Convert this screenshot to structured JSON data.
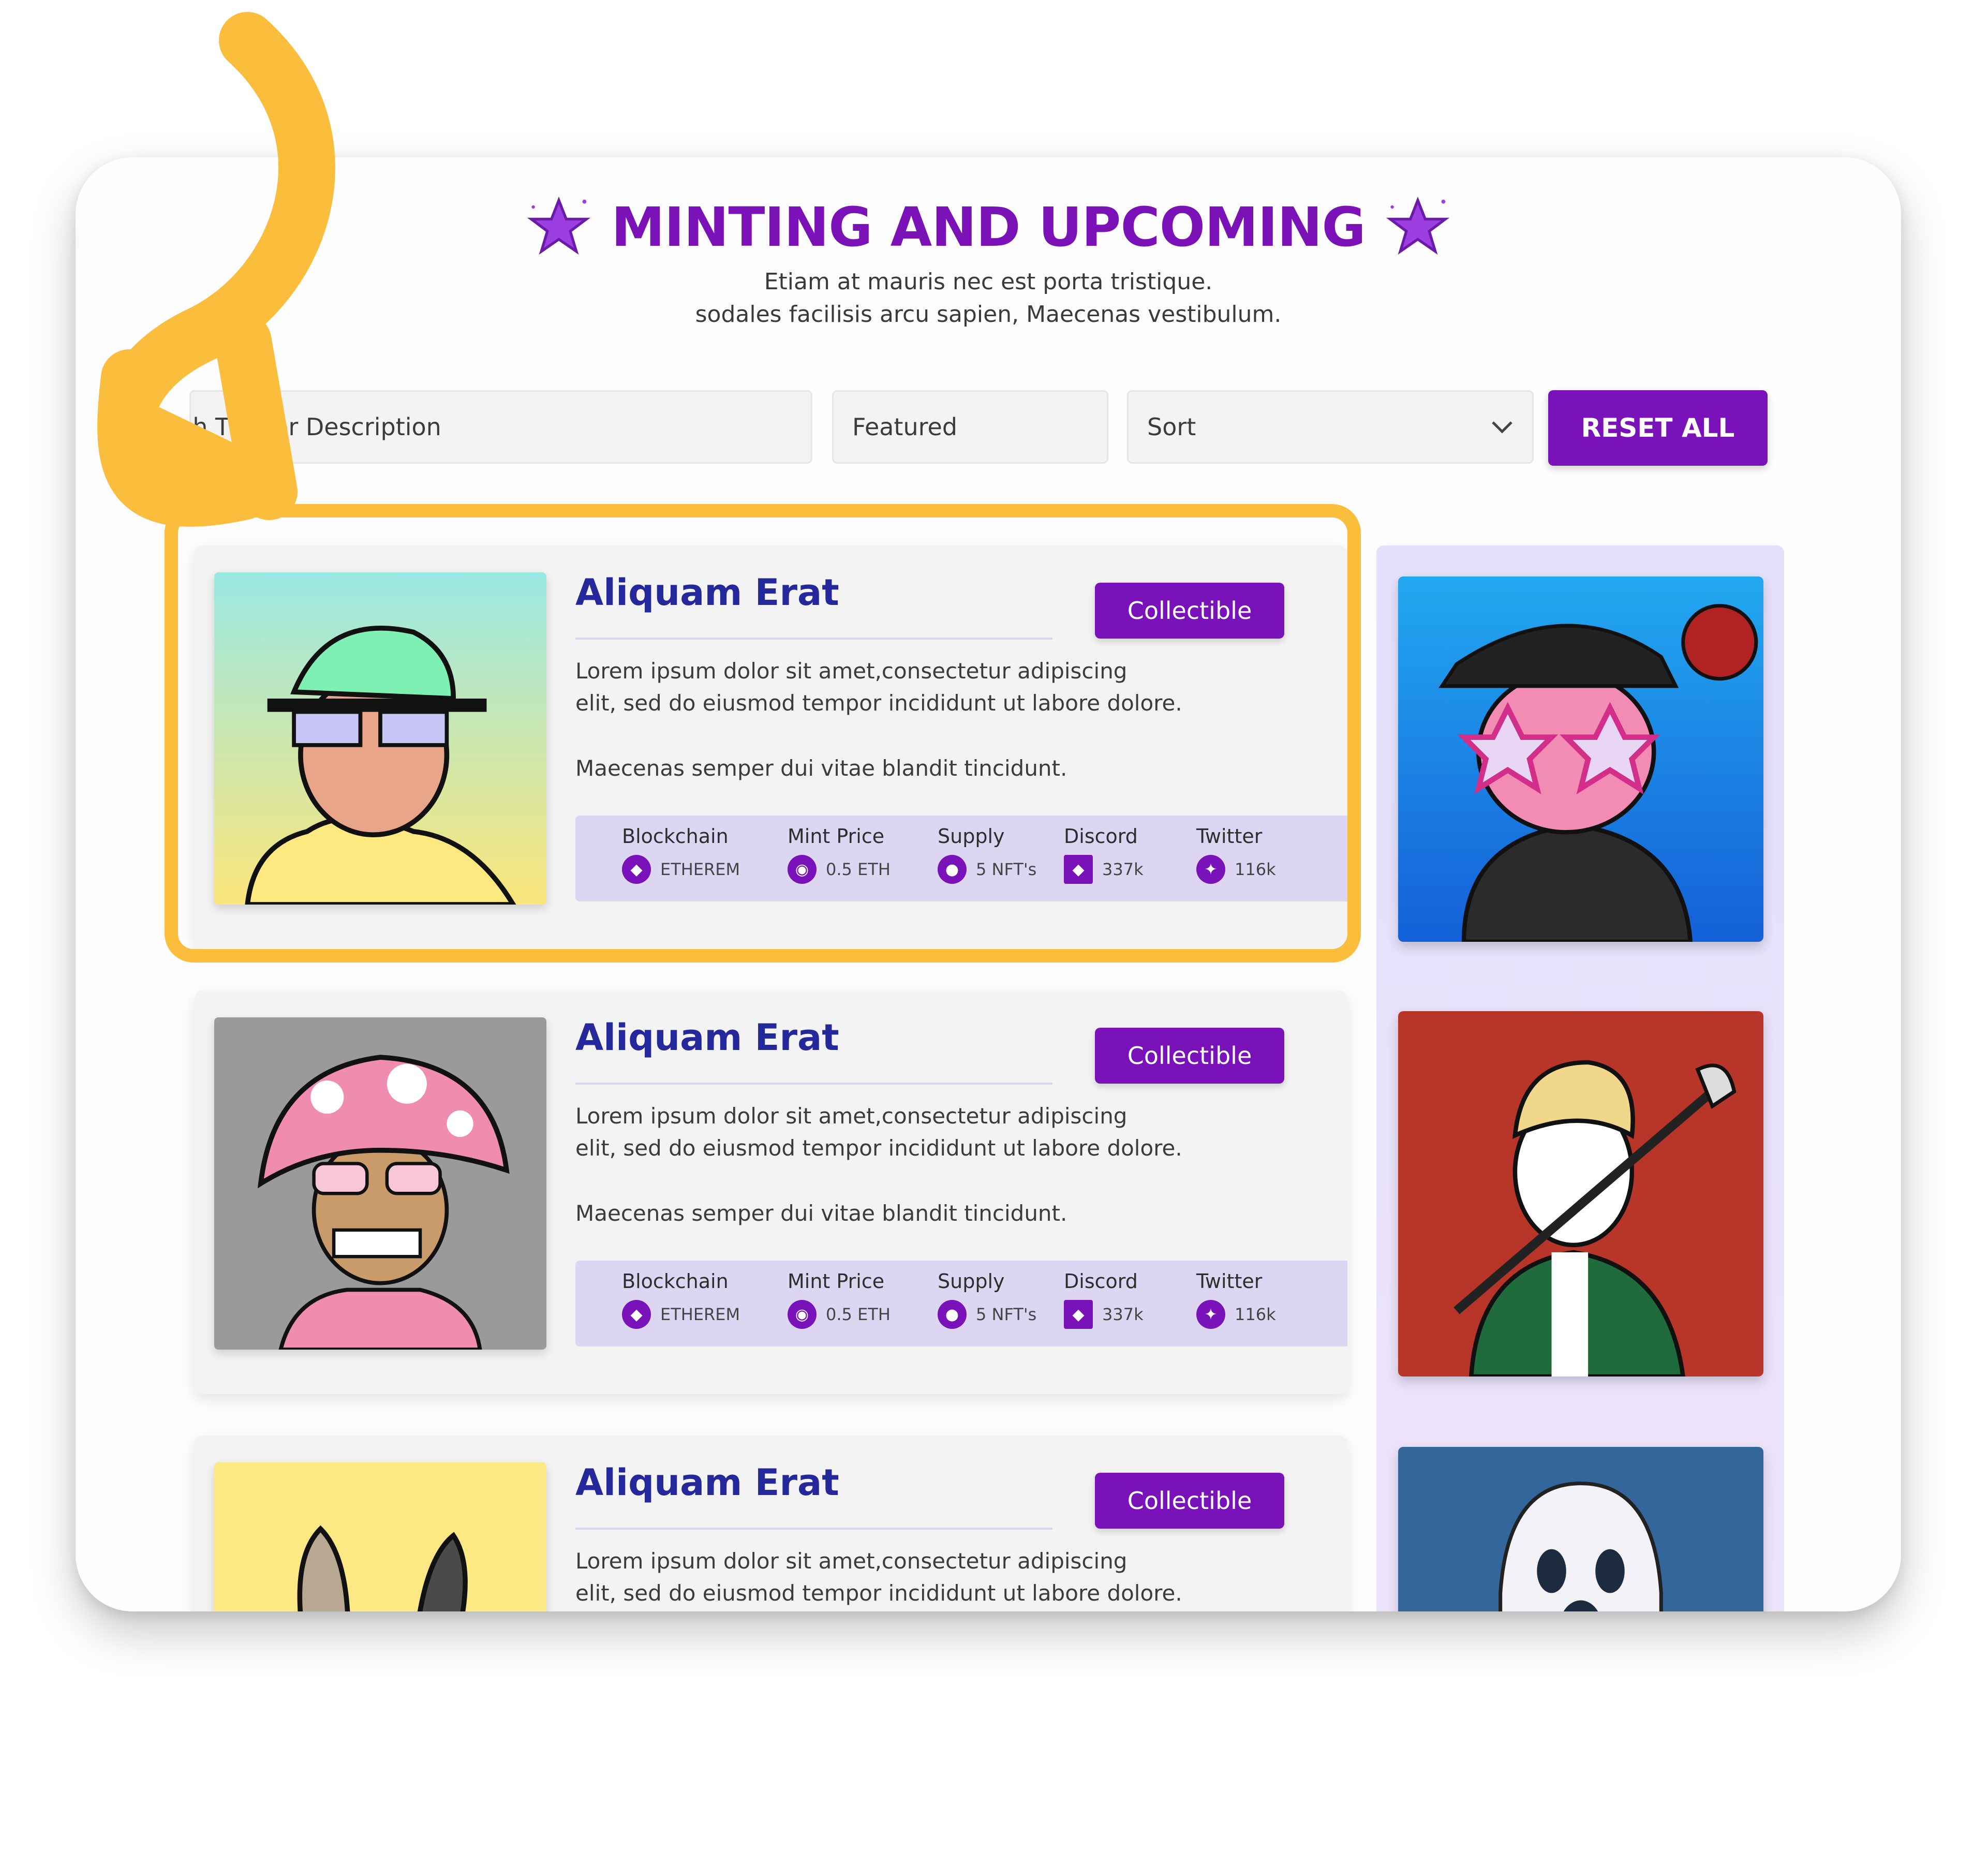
{
  "header": {
    "title": "MINTING AND UPCOMING",
    "subtitle_line1": "Etiam at mauris nec est porta tristique.",
    "subtitle_line2": "sodales facilisis arcu sapien, Maecenas vestibulum."
  },
  "filters": {
    "search_placeholder": "Search Title or Description",
    "search_visible_text": "rch Title or Description",
    "featured_label": "Featured",
    "sort_label": "Sort",
    "reset_label": "RESET ALL"
  },
  "cards": [
    {
      "title": "Aliquam Erat",
      "tag": "Collectible",
      "desc_line1": "Lorem ipsum dolor sit amet,consectetur adipiscing",
      "desc_line2": "elit, sed do eiusmod tempor incididunt ut labore dolore.",
      "desc_line3": "Maecenas semper dui vitae blandit tincidunt.",
      "stats": {
        "blockchain_label": "Blockchain",
        "blockchain_value": "ETHEREM",
        "mint_label": "Mint Price",
        "mint_value": "0.5 ETH",
        "supply_label": "Supply",
        "supply_value": "5 NFT's",
        "discord_label": "Discord",
        "discord_value": "337k",
        "twitter_label": "Twitter",
        "twitter_value": "116k"
      }
    },
    {
      "title": "Aliquam Erat",
      "tag": "Collectible",
      "desc_line1": "Lorem ipsum dolor sit amet,consectetur adipiscing",
      "desc_line2": "elit, sed do eiusmod tempor incididunt ut labore dolore.",
      "desc_line3": "Maecenas semper dui vitae blandit tincidunt.",
      "stats": {
        "blockchain_label": "Blockchain",
        "blockchain_value": "ETHEREM",
        "mint_label": "Mint Price",
        "mint_value": "0.5 ETH",
        "supply_label": "Supply",
        "supply_value": "5 NFT's",
        "discord_label": "Discord",
        "discord_value": "337k",
        "twitter_label": "Twitter",
        "twitter_value": "116k"
      }
    },
    {
      "title": "Aliquam Erat",
      "tag": "Collectible",
      "desc_line1": "Lorem ipsum dolor sit amet,consectetur adipiscing",
      "desc_line2": "elit, sed do eiusmod tempor incididunt ut labore dolore."
    }
  ],
  "colors": {
    "accent": "#7a12b9",
    "title": "#24289a",
    "highlight": "#fbbd3c",
    "stats_bg": "#ddd6f3"
  },
  "icons": {
    "title_decoration": "star-icon",
    "sort_dropdown": "chevron-down-icon",
    "blockchain": "ethereum-icon",
    "mint": "coin-icon",
    "supply": "discord-icon",
    "discord": "diamond-icon",
    "twitter": "twitter-icon"
  }
}
